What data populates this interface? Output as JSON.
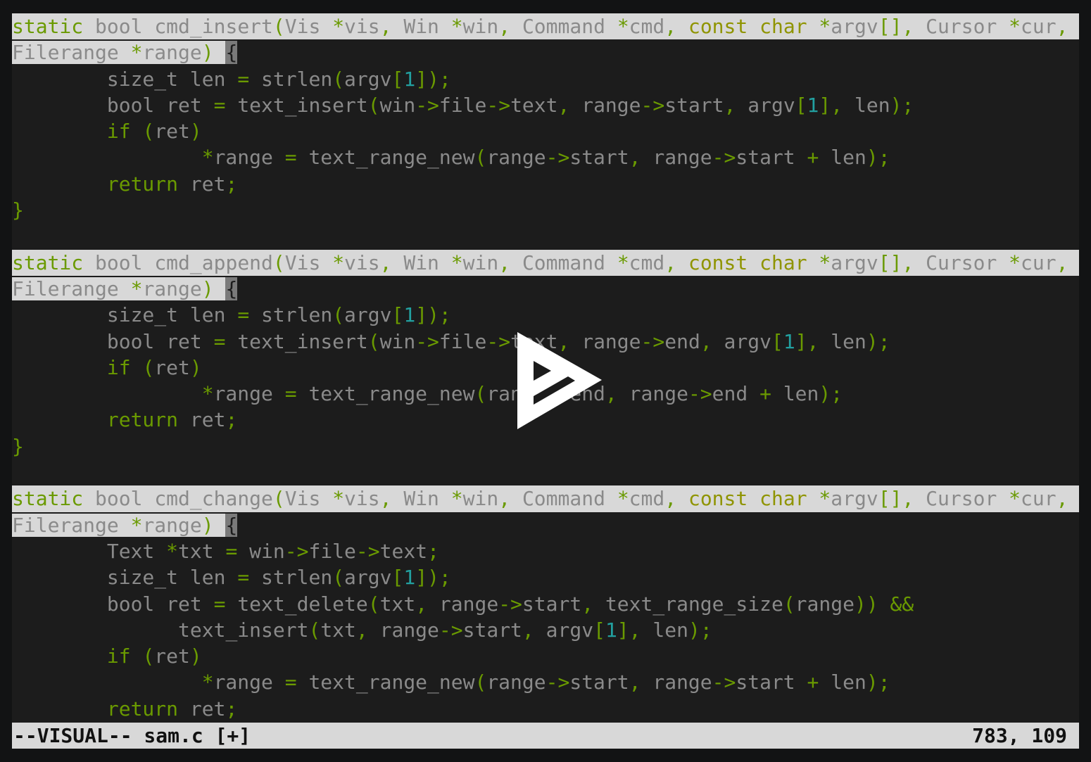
{
  "editor": {
    "lines": [
      "static bool cmd_insert(Vis *vis, Win *win, Command *cmd, const char *argv[], Cursor *cur,",
      "Filerange *range) {",
      "        size_t len = strlen(argv[1]);",
      "        bool ret = text_insert(win->file->text, range->start, argv[1], len);",
      "        if (ret)",
      "                *range = text_range_new(range->start, range->start + len);",
      "        return ret;",
      "}",
      "",
      "static bool cmd_append(Vis *vis, Win *win, Command *cmd, const char *argv[], Cursor *cur,",
      "Filerange *range) {",
      "        size_t len = strlen(argv[1]);",
      "        bool ret = text_insert(win->file->text, range->end, argv[1], len);",
      "        if (ret)",
      "                *range = text_range_new(range->end, range->end + len);",
      "        return ret;",
      "}",
      "",
      "static bool cmd_change(Vis *vis, Win *win, Command *cmd, const char *argv[], Cursor *cur,",
      "Filerange *range) {",
      "        Text *txt = win->file->text;",
      "        size_t len = strlen(argv[1]);",
      "        bool ret = text_delete(txt, range->start, text_range_size(range)) &&",
      "              text_insert(txt, range->start, argv[1], len);",
      "        if (ret)",
      "                *range = text_range_new(range->start, range->start + len);",
      "        return ret;"
    ],
    "selected_full_lines": [
      0,
      9,
      18
    ],
    "selected_partial_lines": [
      1,
      10,
      19
    ]
  },
  "status": {
    "mode_file": "--VISUAL-- sam.c [+]",
    "position": "783, 109"
  },
  "overlay": {
    "icon": "asciinema-play-icon"
  },
  "colors": {
    "keyword": "#6a9a00",
    "type": "#8f9400",
    "number": "#22a0a0",
    "text": "#8a8a8a",
    "selection": "#d8d8d8",
    "background": "#1c1c1c"
  }
}
